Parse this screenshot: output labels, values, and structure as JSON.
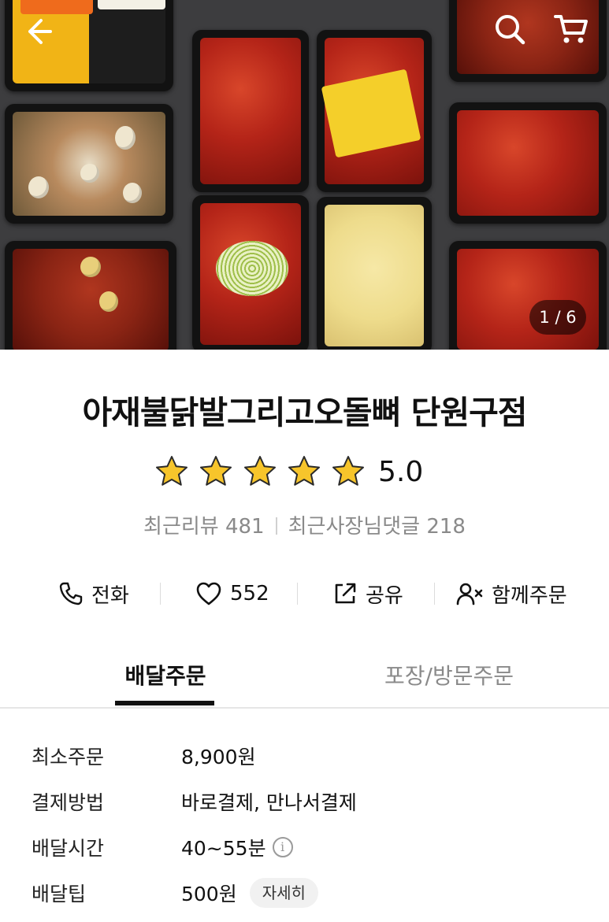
{
  "header": {
    "back_icon": "arrow-left-icon",
    "search_icon": "search-icon",
    "cart_icon": "cart-icon",
    "photo_counter": "1 / 6"
  },
  "store": {
    "name": "아재불닭발그리고오돌뼈 단원구점",
    "rating": "5.0",
    "rating_stars": 5,
    "recent_reviews_label": "최근리뷰 481",
    "owner_replies_label": "최근사장님댓글 218"
  },
  "actions": [
    {
      "label": "전화",
      "icon": "phone-icon"
    },
    {
      "label": "552",
      "icon": "heart-icon"
    },
    {
      "label": "공유",
      "icon": "share-icon"
    },
    {
      "label": "함께주문",
      "icon": "group-order-icon"
    }
  ],
  "tabs": [
    {
      "label": "배달주문",
      "active": true
    },
    {
      "label": "포장/방문주문",
      "active": false
    }
  ],
  "info": {
    "min_order": {
      "label": "최소주문",
      "value": "8,900원"
    },
    "payment": {
      "label": "결제방법",
      "value": "바로결제, 만나서결제"
    },
    "delivery_time": {
      "label": "배달시간",
      "value": "40~55분"
    },
    "delivery_tip": {
      "label": "배달팁",
      "value": "500원",
      "detail_label": "자세히"
    }
  },
  "colors": {
    "star": "#f7c52b",
    "text_primary": "#111111",
    "text_secondary": "#8a8a8a"
  }
}
